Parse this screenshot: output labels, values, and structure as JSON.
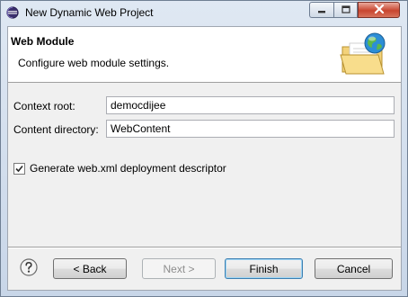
{
  "window": {
    "title": "New Dynamic Web Project"
  },
  "banner": {
    "title": "Web Module",
    "description": "Configure web module settings."
  },
  "form": {
    "context_root_label": "Context root:",
    "context_root_value": "democdijee",
    "content_directory_label": "Content directory:",
    "content_directory_value": "WebContent",
    "generate_descriptor_label": "Generate web.xml deployment descriptor",
    "generate_descriptor_checked": true
  },
  "buttons": {
    "back": "< Back",
    "next": "Next >",
    "finish": "Finish",
    "cancel": "Cancel"
  },
  "icons": {
    "app": "eclipse-icon",
    "banner": "folder-globe-icon",
    "help": "help-icon"
  },
  "colors": {
    "window_frame": "#c8d6e8",
    "close_button": "#c8452f",
    "default_button_border": "#3c7fb1"
  }
}
